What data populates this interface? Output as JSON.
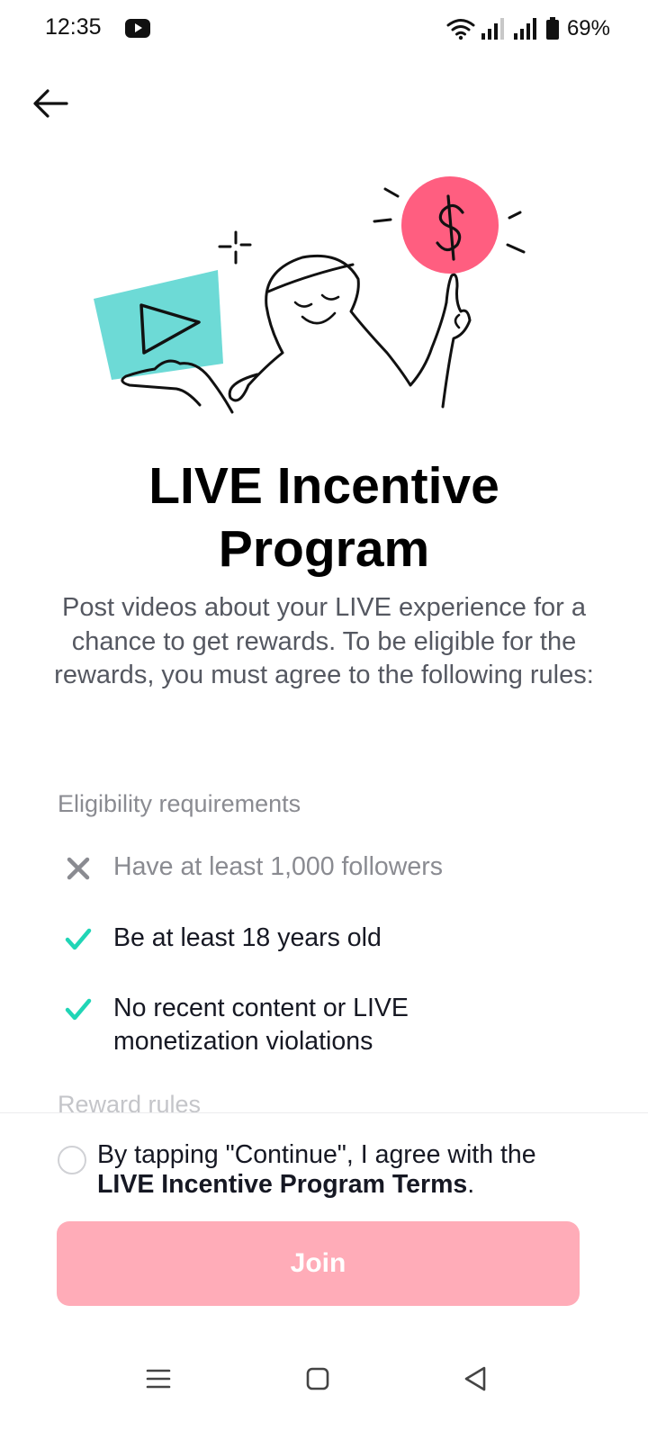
{
  "status_bar": {
    "time": "12:35",
    "battery_percent": "69%",
    "icons": [
      "youtube-icon",
      "wifi-icon",
      "signal-icon",
      "signal-icon",
      "battery-icon"
    ]
  },
  "header": {
    "back_icon": "arrow-left-icon"
  },
  "main": {
    "title": "LIVE Incentive Program",
    "description": "Post videos about your LIVE experience for a chance to get rewards. To be eligible for the rewards, you must agree to the following rules:",
    "eligibility_heading": "Eligibility requirements",
    "requirements": [
      {
        "text": "Have at least 1,000 followers",
        "met": false,
        "icon": "cross-icon"
      },
      {
        "text": "Be at least 18 years old",
        "met": true,
        "icon": "check-icon"
      },
      {
        "text": "No recent content or LIVE monetization violations",
        "met": true,
        "icon": "check-icon"
      }
    ],
    "next_section_heading": "Reward rules"
  },
  "footer": {
    "agree_prefix": "By tapping \"Continue\", I agree with the",
    "agree_link": "LIVE Incentive Program Terms",
    "agree_suffix": ".",
    "join_label": "Join"
  },
  "colors": {
    "accent_pink": "#fe2c55",
    "join_disabled": "#ffacb8",
    "check_teal": "#20d5b6",
    "illustration_teal": "#6ddad6",
    "coin_pink": "#ff5e80",
    "muted_text": "#8a8b91"
  },
  "nav": {
    "icons": [
      "menu-icon",
      "home-icon",
      "back-triangle-icon"
    ]
  }
}
